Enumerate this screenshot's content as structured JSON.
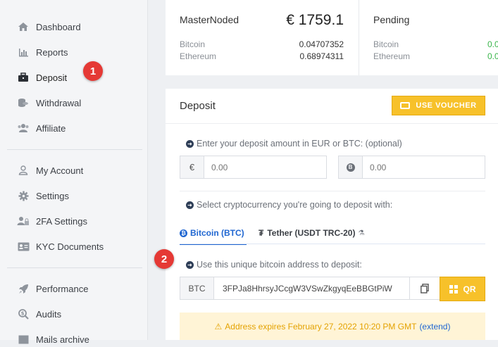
{
  "sidebar": {
    "items": [
      {
        "label": "Dashboard",
        "icon": "home-icon"
      },
      {
        "label": "Reports",
        "icon": "bar-chart-icon"
      },
      {
        "label": "Deposit",
        "icon": "briefcase-icon"
      },
      {
        "label": "Withdrawal",
        "icon": "coins-icon"
      },
      {
        "label": "Affiliate",
        "icon": "users-icon"
      },
      {
        "label": "My Account",
        "icon": "user-icon"
      },
      {
        "label": "Settings",
        "icon": "gear-icon"
      },
      {
        "label": "2FA Settings",
        "icon": "user-lock-icon"
      },
      {
        "label": "KYC Documents",
        "icon": "id-card-icon"
      },
      {
        "label": "Performance",
        "icon": "rocket-icon"
      },
      {
        "label": "Audits",
        "icon": "search-dollar-icon"
      },
      {
        "label": "Mails archive",
        "icon": "inbox-icon"
      }
    ],
    "active": "Deposit"
  },
  "annotations": {
    "badge_1": "1",
    "badge_2": "2"
  },
  "stats": {
    "masternoded": {
      "title": "MasterNoded",
      "total": "€ 1759.1",
      "rows": [
        {
          "label": "Bitcoin",
          "value": "0.04707352"
        },
        {
          "label": "Ethereum",
          "value": "0.68974311"
        }
      ]
    },
    "pending": {
      "title": "Pending",
      "rows": [
        {
          "label": "Bitcoin",
          "value": "0.0"
        },
        {
          "label": "Ethereum",
          "value": "0.0"
        }
      ]
    }
  },
  "deposit": {
    "title": "Deposit",
    "voucher_label": "USE VOUCHER",
    "amount_prompt": "Enter your deposit amount in EUR or BTC: (optional)",
    "eur_addon": "€",
    "eur_value": "0.00",
    "btc_addon": "B",
    "btc_value": "0.00",
    "crypto_prompt": "Select cryptocurrency you're going to deposit with:",
    "tabs": [
      {
        "label": "Bitcoin (BTC)",
        "active": true
      },
      {
        "label": "Tether (USDT TRC-20)",
        "active": false
      }
    ],
    "address_prompt": "Use this unique bitcoin address to deposit:",
    "address_prefix": "BTC",
    "address": "3FPJa8HhrsyJCcgW3VSwZkgyqEeBBGtPiW",
    "qr_label": "QR",
    "expires_text": "Address expires February 27, 2022 10:20 PM GMT",
    "extend_label": "(extend)"
  },
  "colors": {
    "accent": "#f7c12a",
    "primary": "#1f66d1",
    "badge": "#e53935",
    "positive": "#39b54a"
  }
}
